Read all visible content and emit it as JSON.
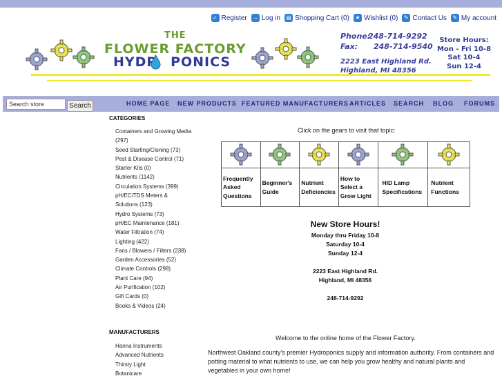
{
  "header_links": [
    {
      "label": "Register",
      "icon": "register-icon"
    },
    {
      "label": "Log in",
      "icon": "login-icon"
    },
    {
      "label": "Shopping Cart (0)",
      "icon": "cart-icon"
    },
    {
      "label": "Wishlist (0)",
      "icon": "wishlist-icon"
    },
    {
      "label": "Contact Us",
      "icon": "contact-icon"
    },
    {
      "label": "My account",
      "icon": "account-icon"
    }
  ],
  "brand": {
    "line1": "THE",
    "line2": "FLOWER FACTORY",
    "line3a": "HYDR",
    "line3b": "PONICS"
  },
  "contact": {
    "phone_label": "Phone:",
    "phone": "248-714-9292",
    "fax_label": "Fax:",
    "fax": "248-714-9540",
    "address1": "2223 East Highland Rd.",
    "address2": "Highland, MI 48356"
  },
  "store_hours": {
    "title": "Store Hours:",
    "lines": [
      "Mon - Fri 10-8",
      "Sat 10-4",
      "Sun 12-4"
    ]
  },
  "search": {
    "value": "Search store",
    "button": "Search"
  },
  "nav": [
    "HOME PAGE",
    "NEW PRODUCTS",
    "FEATURED MANUFACTURERS",
    "ARTICLES",
    "SEARCH",
    "BLOG",
    "FORUMS"
  ],
  "categories": {
    "title": "CATEGORIES",
    "items": [
      "Containers and Growing Media",
      "(297)",
      "Seed Starting/Cloning (73)",
      "Pest & Disease Control (71)",
      "Starter Kits (0)",
      "Nutrients (1142)",
      "Circulation Systems (399)",
      "pH/EC/TDS Meters &",
      "Solutions (123)",
      "Hydro Systems (73)",
      "pH/EC Maintenance (181)",
      "Water Filtration (74)",
      "Lighting (422)",
      "Fans / Blowers / Filters (238)",
      "Garden Accessories (52)",
      "Climate Controls (298)",
      "Plant Care (94)",
      "Air Purification (102)",
      "Gift Cards (0)",
      "Books & Videos (24)"
    ]
  },
  "manufacturers": {
    "title": "MANUFACTURERS",
    "items": [
      "Hanna Instruments",
      "Advanced Nutrients",
      "Thirsty Light",
      "Botanicare"
    ]
  },
  "topics": {
    "caption": "Click on the gears to visit that topic:",
    "items": [
      {
        "label": "Frequently Asked Questions",
        "gear_color": "#9ba3d6"
      },
      {
        "label": "Beginner's Guide",
        "gear_color": "#8ec77a"
      },
      {
        "label": "Nutrient Deficiencies",
        "gear_color": "#e8e34a"
      },
      {
        "label": "How to Select a Grow Light",
        "gear_color": "#9ba3d6"
      },
      {
        "label": "HID Lamp Specifications",
        "gear_color": "#8ec77a"
      },
      {
        "label": "Nutrient Functions",
        "gear_color": "#e8e34a"
      }
    ]
  },
  "new_hours": {
    "title": "New Store Hours!",
    "lines": [
      "Monday thru Friday 10-8",
      "Saturday 10-4",
      "Sunday 12-4",
      "",
      "2223 East Highland Rd.",
      "Highland, MI 48356",
      "",
      "248-714-9292"
    ]
  },
  "welcome": "Welcome to the online home of the Flower Factory.",
  "intro": "Northwest Oakland county's premier Hydroponics supply and information authority.  From containers and potting material to what nutrients to use, we can help you grow healthy and natural plants and vegetables in your own home!"
}
